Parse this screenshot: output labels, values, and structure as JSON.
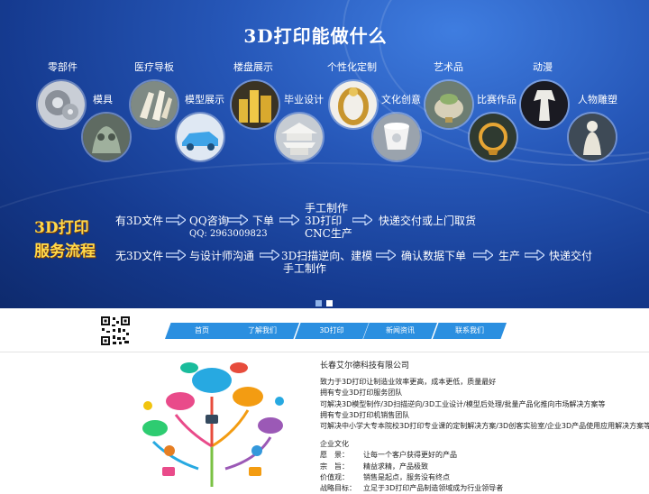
{
  "banner": {
    "title": "3D打印能做什么",
    "categories": {
      "parts": "零部件",
      "mold": "模具",
      "medical": "医疗导板",
      "model": "模型展示",
      "building": "楼盘展示",
      "graduation": "毕业设计",
      "custom": "个性化定制",
      "creative": "文化创意",
      "crafts": "艺术品",
      "contest": "比赛作品",
      "anime": "动漫",
      "figure": "人物雕塑"
    },
    "flow_title_1": "3D打印",
    "flow_title_2": "服务流程",
    "flow1": {
      "step1": "有3D文件",
      "step2": "QQ咨询",
      "qq": "QQ: 2963009823",
      "step3": "下单",
      "step4a": "手工制作",
      "step4b": "3D打印",
      "step4c": "CNC生产",
      "step5": "快递交付或上门取货"
    },
    "flow2": {
      "step1": "无3D文件",
      "step2": "与设计师沟通",
      "step3a": "3D扫描逆向、建模",
      "step3b": "手工制作",
      "step4": "确认数据下单",
      "step5": "生产",
      "step6": "快递交付"
    }
  },
  "nav": {
    "items": [
      "首页",
      "了解我们",
      "3D打印",
      "新闻资讯",
      "联系我们"
    ]
  },
  "company": {
    "name": "长春艾尔德科技有限公司",
    "lines": [
      "致力于3D打印让制造业效率更高，成本更低，质量最好",
      "拥有专业3D打印服务团队",
      "可解决3D模型制作/3D扫描逆向/3D工业设计/模型后处理/批量产品化推向市场解决方案等",
      "拥有专业3D打印机销售团队",
      "可解决中小学大专本院校3D打印专业课的定制解决方案/3D创客实验室/企业3D产品使用应用解决方案等"
    ],
    "culture_title": "企业文化",
    "culture": [
      {
        "k": "愿　景：",
        "v": "让每一个客户获得更好的产品"
      },
      {
        "k": "宗　旨：",
        "v": "精益求精，产品极致"
      },
      {
        "k": "价值观：",
        "v": "销售是起点，服务没有终点"
      },
      {
        "k": "战略目标：",
        "v": "立足于3D打印产品制造领域成为行业领导者"
      }
    ]
  },
  "colors": {
    "nav": "#2b8fe0",
    "banner": "#2657b8",
    "flow_title": "#ffd84a"
  }
}
